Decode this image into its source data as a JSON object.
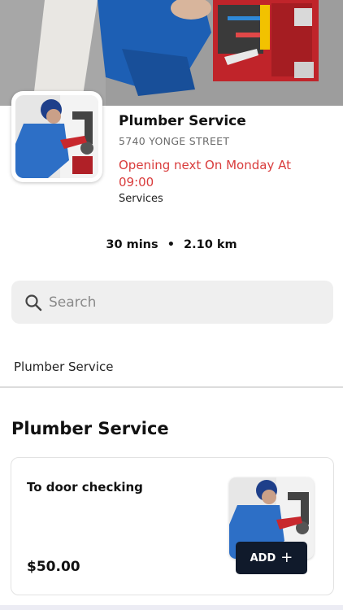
{
  "store": {
    "name": "Plumber Service",
    "address": "5740 YONGE STREET",
    "status": "Opening next On Monday At 09:00",
    "category": "Services",
    "delivery_time": "30 mins",
    "distance": "2.10 km"
  },
  "search": {
    "placeholder": "Search"
  },
  "category_tabs": [
    {
      "label": "Plumber Service"
    }
  ],
  "section": {
    "title": "Plumber Service",
    "items": [
      {
        "name": "To door checking",
        "price": "$50.00",
        "add_label": "ADD"
      }
    ]
  },
  "colors": {
    "status_red": "#d93c3c",
    "add_button": "#101a2b",
    "search_bg": "#efefef"
  },
  "icons": [
    "search-icon",
    "plus-icon"
  ]
}
